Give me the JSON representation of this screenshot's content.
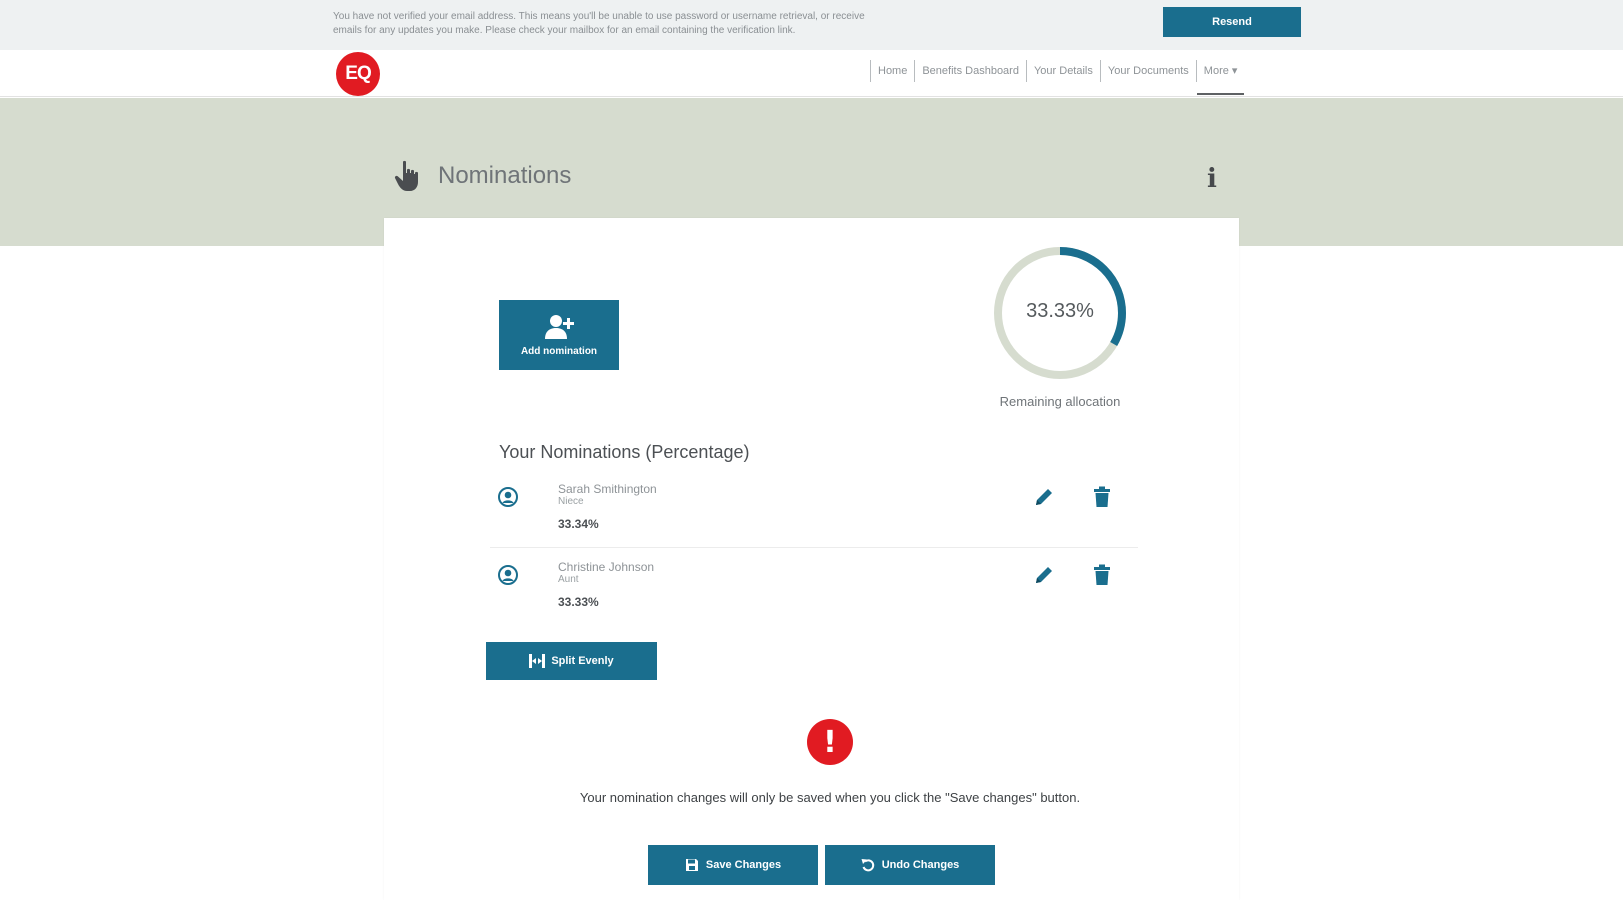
{
  "banner": {
    "message": "You have not verified your email address. This means you'll be unable to use password or username retrieval, or receive emails for any updates you make. Please check your mailbox for an email containing the verification link.",
    "resend_label": "Resend"
  },
  "header": {
    "logo_text": "EQ",
    "nav": [
      {
        "label": "Home"
      },
      {
        "label": "Benefits Dashboard"
      },
      {
        "label": "Your Details"
      },
      {
        "label": "Your Documents"
      },
      {
        "label": "More ▾",
        "active": true
      }
    ]
  },
  "page": {
    "title": "Nominations",
    "info_icon": "i"
  },
  "add_nomination": {
    "label": "Add nomination",
    "icon": "user-plus-icon"
  },
  "allocation": {
    "value_text": "33.33%",
    "remaining_fraction": 0.3333,
    "caption": "Remaining allocation",
    "colors": {
      "filled": "#1a6e8e",
      "track": "#d6dccf"
    }
  },
  "nominations": {
    "title": "Your Nominations (Percentage)",
    "items": [
      {
        "name": "Sarah Smithington",
        "relationship": "Niece",
        "percentage": "33.34%"
      },
      {
        "name": "Christine Johnson",
        "relationship": "Aunt",
        "percentage": "33.33%"
      }
    ]
  },
  "split_evenly": {
    "label": "Split Evenly"
  },
  "alert": {
    "symbol": "!",
    "message": "Your nomination changes will only be saved when you click the \"Save changes\" button."
  },
  "actions": {
    "save_label": "Save Changes",
    "undo_label": "Undo Changes"
  },
  "colors": {
    "primary": "#1a6e8e",
    "brand_red": "#e11b22",
    "title_band": "#d6dccf"
  }
}
